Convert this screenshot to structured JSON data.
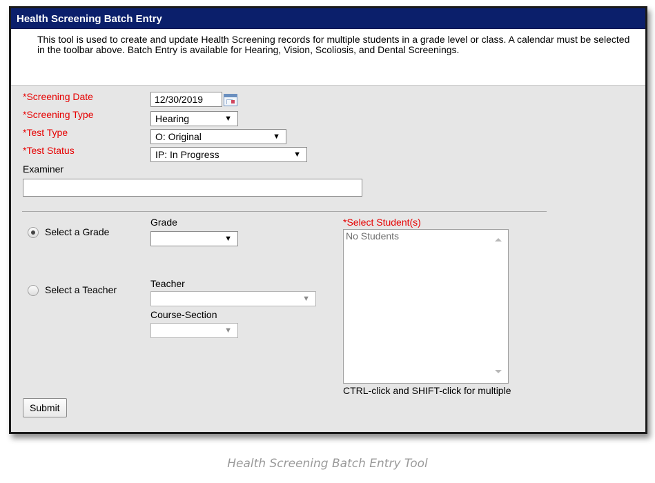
{
  "header": {
    "title": "Health Screening Batch Entry"
  },
  "description": "This tool is used to create and update Health Screening records for multiple students in a grade level or class. A calendar must be selected in the toolbar above. Batch Entry is available for Hearing, Vision, Scoliosis, and Dental Screenings.",
  "form": {
    "screening_date": {
      "label": "*Screening Date",
      "value": "12/30/2019"
    },
    "screening_type": {
      "label": "*Screening Type",
      "value": "Hearing"
    },
    "test_type": {
      "label": "*Test Type",
      "value": "O: Original"
    },
    "test_status": {
      "label": "*Test Status",
      "value": "IP: In Progress"
    },
    "examiner": {
      "label": "Examiner",
      "value": ""
    }
  },
  "selection": {
    "grade_option": {
      "label": "Select a Grade",
      "checked": true
    },
    "teacher_option": {
      "label": "Select a Teacher",
      "checked": false
    },
    "grade": {
      "label": "Grade",
      "value": ""
    },
    "teacher": {
      "label": "Teacher",
      "value": ""
    },
    "course_section": {
      "label": "Course-Section",
      "value": ""
    },
    "students": {
      "label": "*Select Student(s)",
      "items": [
        "No Students"
      ],
      "hint": "CTRL-click and SHIFT-click for multiple"
    }
  },
  "actions": {
    "submit_label": "Submit"
  },
  "caption": "Health Screening Batch Entry Tool",
  "colors": {
    "header_bg": "#0b1f6b",
    "required": "#e60000",
    "panel_bg": "#e6e6e6"
  }
}
